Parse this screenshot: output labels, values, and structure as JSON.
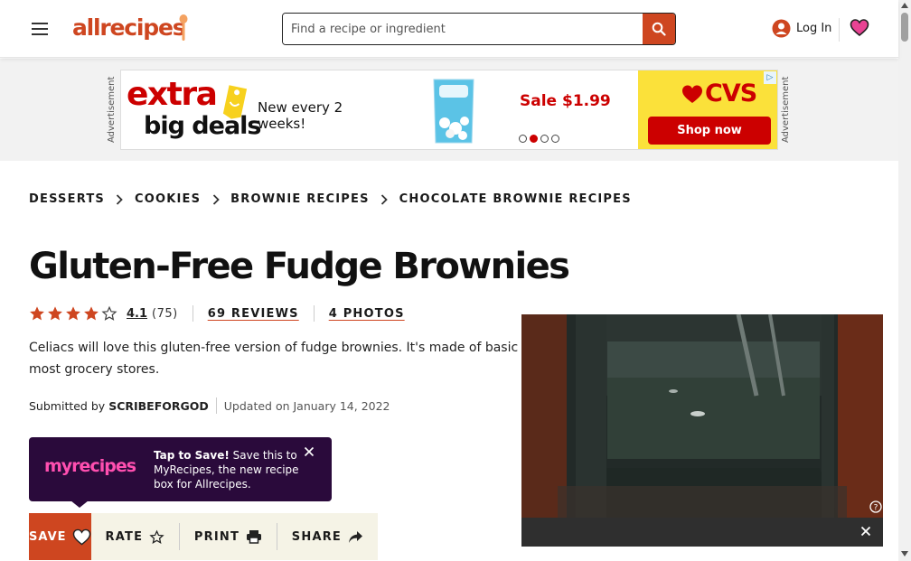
{
  "header": {
    "logo_text": "allrecipes",
    "search_placeholder": "Find a recipe or ingredient",
    "login_label": "Log In",
    "brand_color": "#ce4620"
  },
  "ad": {
    "label": "Advertisement",
    "headline_1": "extra",
    "headline_2": "big deals",
    "tagline": "New every 2 weeks!",
    "sale": "Sale $1.99",
    "brand": "CVS",
    "cta": "Shop now",
    "carousel_active_index": 2,
    "carousel_total": 4
  },
  "breadcrumb": [
    "DESSERTS",
    "COOKIES",
    "BROWNIE RECIPES",
    "CHOCOLATE BROWNIE RECIPES"
  ],
  "recipe": {
    "title": "Gluten-Free Fudge Brownies",
    "rating": "4.1",
    "rating_count": "(75)",
    "reviews": "69 REVIEWS",
    "photos": "4 PHOTOS",
    "description": "Celiacs will love this gluten-free version of fudge brownies. It's made of basic ingredients found in most grocery stores.",
    "submitted_label": "Submitted by",
    "author": "SCRIBEFORGOD",
    "updated": "Updated on January 14, 2022"
  },
  "myrecipes": {
    "logo": "myrecipes",
    "bold": "Tap to Save!",
    "text": " Save this to MyRecipes, the new recipe box for Allrecipes."
  },
  "actions": {
    "save": "SAVE",
    "rate": "RATE",
    "print": "PRINT",
    "share": "SHARE"
  }
}
